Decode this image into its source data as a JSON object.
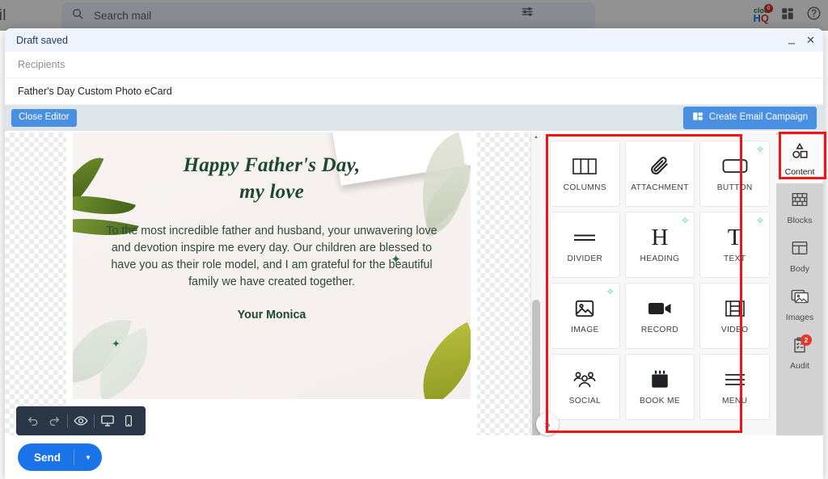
{
  "gmail": {
    "logo_text": "ail",
    "search_placeholder": "Search mail",
    "tune_icon": "tune-icon",
    "cloudhq": {
      "line1": "clou",
      "line2": "HQ",
      "badge": "0"
    },
    "apps_icon": "apps-icon",
    "help_icon": "help-icon"
  },
  "compose": {
    "status_title": "Draft saved",
    "minimize_label": "–",
    "close_label": "✕",
    "recipients_placeholder": "Recipients",
    "subject_value": "Father's Day Custom Photo eCard",
    "toolbar": {
      "close_editor_label": "Close Editor",
      "create_campaign_label": "Create Email Campaign",
      "campaign_icon": "campaign-icon"
    },
    "send": {
      "label": "Send",
      "caret": "▼"
    }
  },
  "ecard": {
    "heading_line1": "Happy Father's Day,",
    "heading_line2": "my love",
    "message": "To the most incredible father and husband, your unwavering love and devotion inspire me every day. Our children are blessed to have you as their role model, and I am grateful for the beautiful family we have created together.",
    "signature": "Your Monica",
    "sparkle": "✦",
    "colors": {
      "heading": "#1d4a2e",
      "body": "#2c4a35",
      "background": "#f6f1ef"
    }
  },
  "preview_toolbar": {
    "undo_icon": "undo-icon",
    "redo_icon": "redo-icon",
    "preview_icon": "eye-icon",
    "desktop_icon": "desktop-icon",
    "mobile_icon": "mobile-icon"
  },
  "canvas": {
    "collapse_label": "»",
    "scroll_up": "▲",
    "scroll_down": "▼"
  },
  "content_panel": {
    "ai_badge": "✧",
    "tiles": [
      {
        "label": "COLUMNS",
        "icon": "columns-icon",
        "ai": false
      },
      {
        "label": "ATTACHMENT",
        "icon": "attachment-icon",
        "ai": false
      },
      {
        "label": "BUTTON",
        "icon": "button-icon",
        "ai": true
      },
      {
        "label": "DIVIDER",
        "icon": "divider-icon",
        "ai": false
      },
      {
        "label": "HEADING",
        "icon": "heading-icon",
        "ai": true
      },
      {
        "label": "TEXT",
        "icon": "text-icon",
        "ai": true
      },
      {
        "label": "IMAGE",
        "icon": "image-icon",
        "ai": true
      },
      {
        "label": "RECORD",
        "icon": "record-icon",
        "ai": false
      },
      {
        "label": "VIDEO",
        "icon": "video-icon",
        "ai": false
      },
      {
        "label": "SOCIAL",
        "icon": "social-icon",
        "ai": false
      },
      {
        "label": "BOOK ME",
        "icon": "calendar-icon",
        "ai": false
      },
      {
        "label": "MENU",
        "icon": "menu-icon",
        "ai": false
      }
    ]
  },
  "rail": {
    "items": [
      {
        "label": "Content",
        "icon": "shapes-icon",
        "active": true,
        "badge": null
      },
      {
        "label": "Blocks",
        "icon": "blocks-icon",
        "active": false,
        "badge": null
      },
      {
        "label": "Body",
        "icon": "body-icon",
        "active": false,
        "badge": null
      },
      {
        "label": "Images",
        "icon": "images-icon",
        "active": false,
        "badge": null
      },
      {
        "label": "Audit",
        "icon": "audit-icon",
        "active": false,
        "badge": "2"
      }
    ]
  },
  "annotations": {
    "highlight_color": "#f01414",
    "boxes": [
      "content-tiles-grid",
      "content-rail-tab"
    ]
  }
}
